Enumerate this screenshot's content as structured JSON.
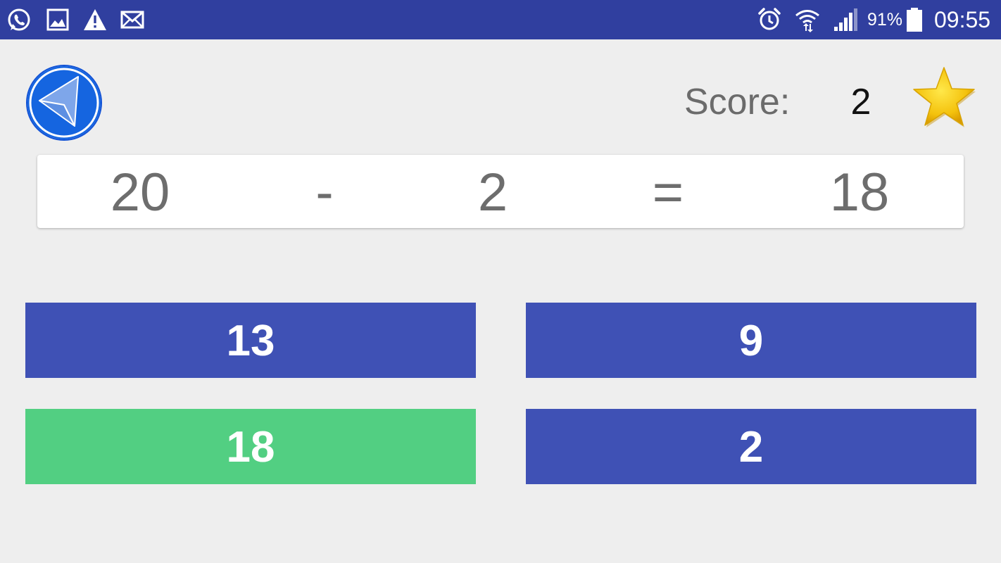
{
  "status_bar": {
    "background": "#303f9f",
    "left_icons": [
      "whatsapp-icon",
      "gallery-icon",
      "warning-icon",
      "mail-icon"
    ],
    "right_icons": [
      "alarm-icon",
      "wifi-icon",
      "signal-icon",
      "battery-icon"
    ],
    "battery_percent": "91%",
    "time": "09:55"
  },
  "header": {
    "back_icon": "navigation-back-icon",
    "score_label": "Score:",
    "score_value": "2",
    "star_icon": "star-icon"
  },
  "equation": {
    "operand_1": "20",
    "operator": "-",
    "operand_2": "2",
    "equals": "=",
    "result": "18"
  },
  "answers": [
    {
      "label": "13",
      "color": "#3f51b5",
      "state": "default"
    },
    {
      "label": "9",
      "color": "#3f51b5",
      "state": "default"
    },
    {
      "label": "18",
      "color": "#52cf82",
      "state": "correct"
    },
    {
      "label": "2",
      "color": "#3f51b5",
      "state": "default"
    }
  ]
}
